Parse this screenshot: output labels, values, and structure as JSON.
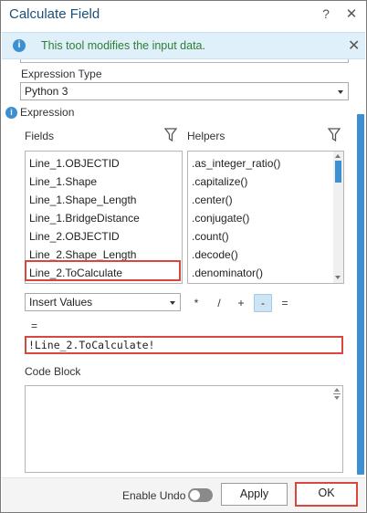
{
  "window": {
    "title": "Calculate Field",
    "help_glyph": "?",
    "close_glyph": "✕"
  },
  "banner": {
    "icon_glyph": "i",
    "message": "This tool modifies the input data.",
    "close_glyph": "✕"
  },
  "expression_type": {
    "label": "Expression Type",
    "value": "Python 3"
  },
  "expression": {
    "label": "Expression",
    "info_glyph": "i"
  },
  "fields": {
    "label": "Fields",
    "items": [
      "Line_1.OBJECTID",
      "Line_1.Shape",
      "Line_1.Shape_Length",
      "Line_1.BridgeDistance",
      "Line_2.OBJECTID",
      "Line_2.Shape_Length",
      "Line_2.ToCalculate"
    ],
    "selected": "Line_2.ToCalculate"
  },
  "helpers": {
    "label": "Helpers",
    "items": [
      ".as_integer_ratio()",
      ".capitalize()",
      ".center()",
      ".conjugate()",
      ".count()",
      ".decode()",
      ".denominator()"
    ]
  },
  "insert": {
    "value": "Insert Values"
  },
  "operators": [
    "*",
    "/",
    "+",
    "-",
    "="
  ],
  "active_operator": "-",
  "assignment": {
    "equals": "=",
    "expression_text": "!Line_2.ToCalculate!"
  },
  "code_block": {
    "label": "Code Block"
  },
  "footer": {
    "enable_undo_label": "Enable Undo",
    "enable_undo_on": false,
    "apply_label": "Apply",
    "ok_label": "OK"
  },
  "colors": {
    "accent": "#3c8fd0",
    "title": "#1e4e7a",
    "highlight_border": "#d9453f",
    "banner_bg": "#e0f0fa",
    "banner_text": "#2e7d32"
  }
}
